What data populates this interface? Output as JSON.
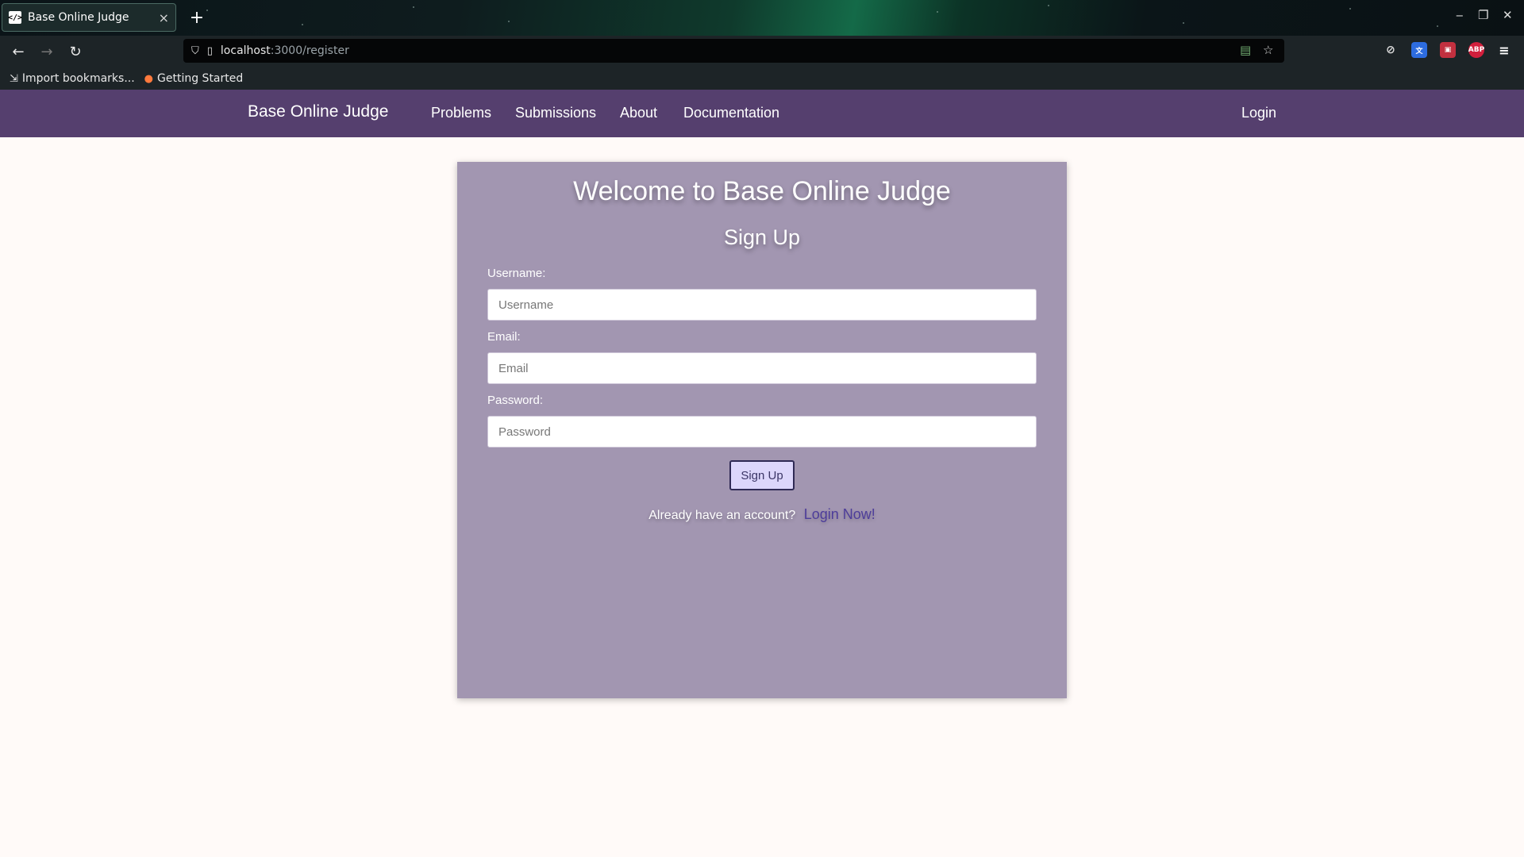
{
  "browser": {
    "tab_title": "Base Online Judge",
    "tab_favicon": "code-icon",
    "url_host": "localhost",
    "url_path": ":3000/register",
    "bookmarks": [
      {
        "label": "Import bookmarks...",
        "icon": "import-icon"
      },
      {
        "label": "Getting Started",
        "icon": "firefox-icon"
      }
    ],
    "extensions": [
      {
        "name": "pocket-icon",
        "color": "#1d2427"
      },
      {
        "name": "translate-icon",
        "color": "#2d6cdf"
      },
      {
        "name": "image-icon",
        "color": "#c2303f"
      },
      {
        "name": "adblock-icon",
        "color": "#d21f3c",
        "text": "ABP"
      }
    ]
  },
  "navbar": {
    "brand": "Base Online Judge",
    "links": [
      "Problems",
      "Submissions",
      "About",
      "Documentation"
    ],
    "login": "Login",
    "bg_color": "#553f6e"
  },
  "form": {
    "title": "Welcome to Base Online Judge",
    "subtitle": "Sign Up",
    "fields": [
      {
        "label": "Username:",
        "placeholder": "Username",
        "value": ""
      },
      {
        "label": "Email:",
        "placeholder": "Email",
        "value": ""
      },
      {
        "label": "Password:",
        "placeholder": "Password",
        "value": ""
      }
    ],
    "submit_label": "Sign Up",
    "already_text": "Already have an account?",
    "login_link": "Login Now!",
    "card_color": "#a296b1"
  }
}
